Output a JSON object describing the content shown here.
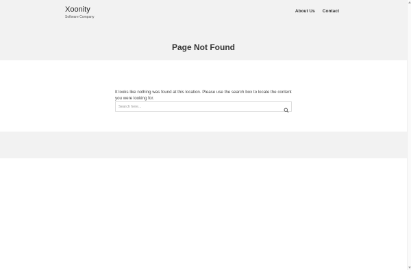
{
  "site": {
    "title": "Xoonity",
    "tagline": "Software Company"
  },
  "nav": {
    "items": [
      {
        "label": "About Us"
      },
      {
        "label": "Contact"
      }
    ]
  },
  "page": {
    "title": "Page Not Found",
    "message": "It looks like nothing was found at this location. Please use the search box to locate the content you were looking for."
  },
  "search": {
    "placeholder": "Search here...",
    "value": ""
  },
  "icons": {
    "search": "search-icon"
  },
  "colors": {
    "band": "#f2f2f2",
    "text": "#333333"
  }
}
